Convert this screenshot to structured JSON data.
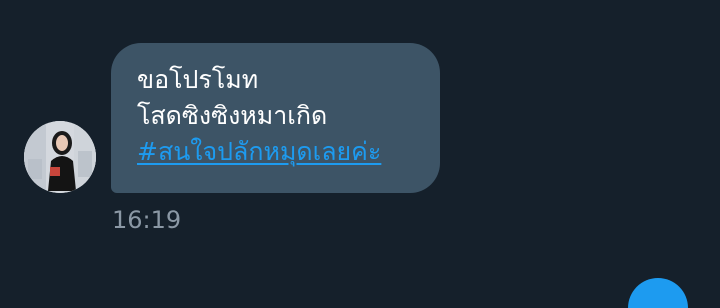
{
  "conversation": {
    "message": {
      "line1": "ขอโปรโมท",
      "line2": "โสดซิงซิงหมาเกิด",
      "hashtag": "#สนใจปลักหมุดเลยค่ะ",
      "time": "16:19"
    }
  },
  "colors": {
    "background": "#15202b",
    "bubble": "#3d5466",
    "link": "#1d9bf0",
    "timestamp": "#8b98a5"
  },
  "icons": {
    "avatar": "user-profile-photo"
  }
}
